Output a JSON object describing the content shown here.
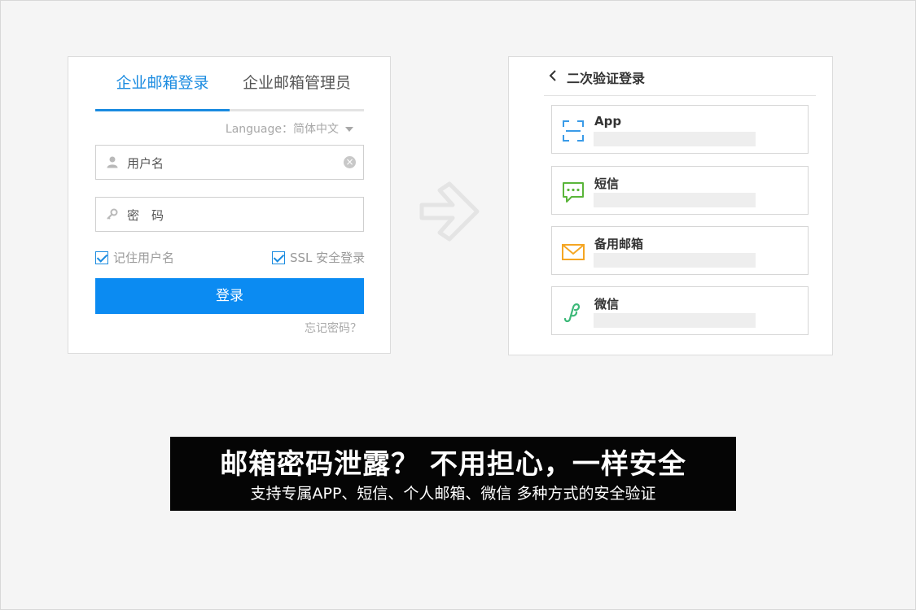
{
  "login": {
    "tabs": [
      "企业邮箱登录",
      "企业邮箱管理员"
    ],
    "language_label": "Language：简体中文",
    "username_placeholder": "用户名",
    "password_placeholder": "密　码",
    "remember_label": "记住用户名",
    "ssl_label": "SSL 安全登录",
    "login_button": "登录",
    "forgot_link": "忘记密码？",
    "accent_color": "#1a8be0",
    "button_color": "#0b8bf2"
  },
  "tfa": {
    "title": "二次验证登录",
    "methods": [
      {
        "name": "App",
        "icon": "scan-icon",
        "color": "#3a9be8"
      },
      {
        "name": "短信",
        "icon": "sms-icon",
        "color": "#5ab53a"
      },
      {
        "name": "备用邮箱",
        "icon": "mail-icon",
        "color": "#f5a623"
      },
      {
        "name": "微信",
        "icon": "wechat-icon",
        "color": "#3cb878"
      }
    ]
  },
  "banner": {
    "headline": "邮箱密码泄露？ 不用担心，一样安全",
    "subline": "支持专属APP、短信、个人邮箱、微信 多种方式的安全验证"
  }
}
